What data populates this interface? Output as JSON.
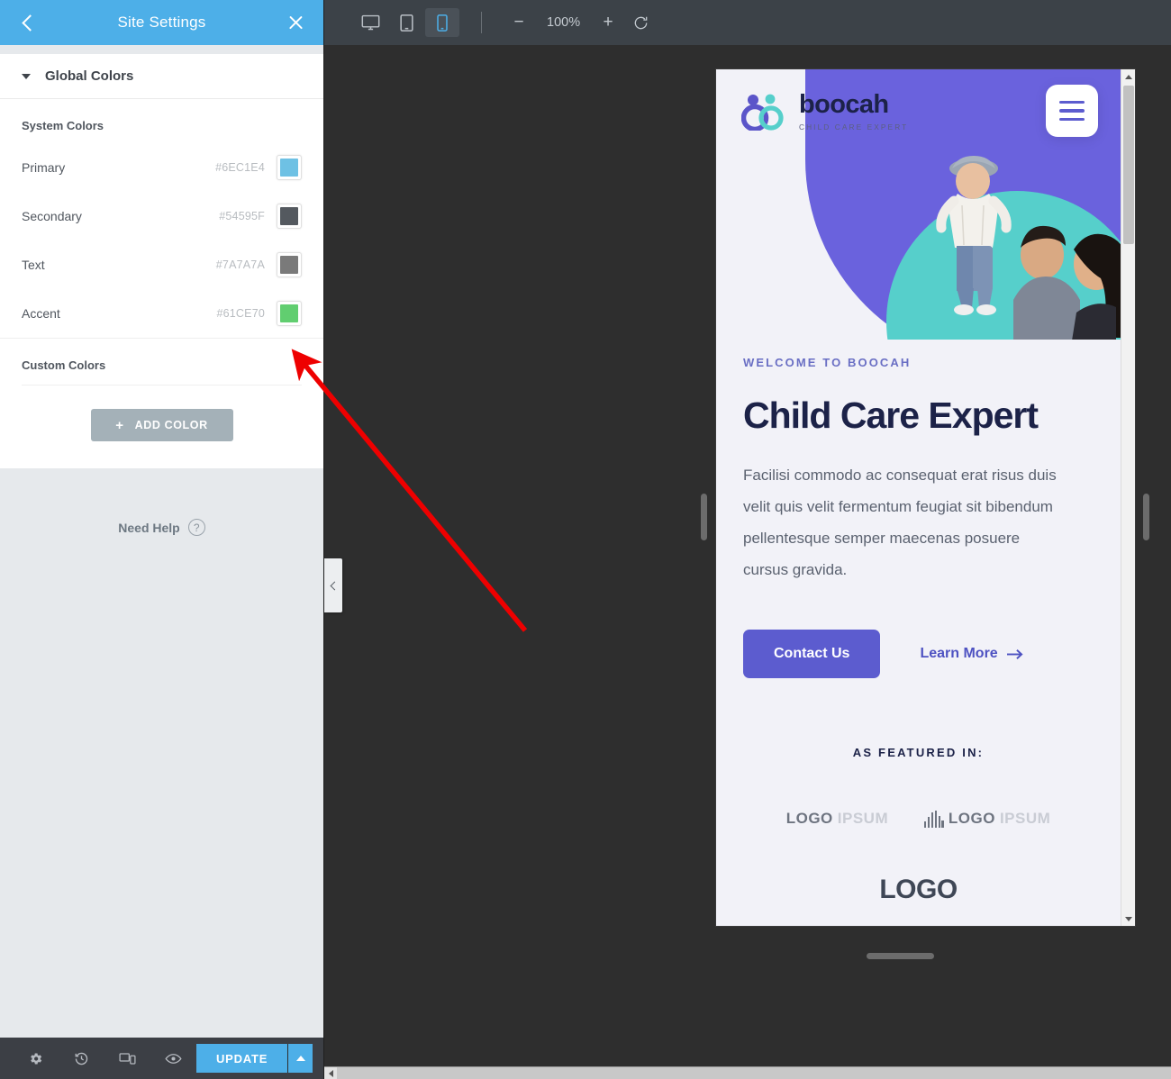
{
  "panel": {
    "header": {
      "title": "Site Settings",
      "back_icon": "chevron-left-icon",
      "close_icon": "close-icon"
    },
    "accordion": {
      "label": "Global Colors"
    },
    "system_colors": {
      "title": "System Colors",
      "rows": [
        {
          "name": "Primary",
          "hex": "#6EC1E4"
        },
        {
          "name": "Secondary",
          "hex": "#54595F"
        },
        {
          "name": "Text",
          "hex": "#7A7A7A"
        },
        {
          "name": "Accent",
          "hex": "#61CE70"
        }
      ]
    },
    "custom_colors": {
      "title": "Custom Colors",
      "add_button": "ADD COLOR",
      "add_icon": "plus-icon"
    },
    "need_help": {
      "label": "Need Help",
      "icon": "question-circle-icon"
    },
    "footer": {
      "icons": [
        "gear-icon",
        "history-icon",
        "responsive-mode-icon",
        "preview-icon"
      ],
      "update_label": "UPDATE",
      "caret_icon": "caret-up-icon"
    }
  },
  "toolbar": {
    "devices": [
      {
        "name": "desktop",
        "active": false
      },
      {
        "name": "tablet",
        "active": false
      },
      {
        "name": "mobile",
        "active": true
      }
    ],
    "zoom_out": "−",
    "zoom_value": "100%",
    "zoom_in": "+",
    "reset_icon": "reset-icon"
  },
  "preview": {
    "logo": {
      "name": "boocah",
      "tagline": "CHILD CARE EXPERT"
    },
    "menu_icon": "hamburger-menu-icon",
    "eyebrow": "WELCOME TO BOOCAH",
    "heading": "Child Care Expert",
    "paragraph": "Facilisi commodo ac consequat erat risus duis velit quis velit fermentum feugiat sit bibendum pellentesque semper maecenas posuere cursus gravida.",
    "primary_cta": "Contact Us",
    "secondary_cta": "Learn More",
    "secondary_cta_icon": "arrow-right-icon",
    "featured_label": "AS FEATURED IN:",
    "featured_logos": [
      {
        "bold": "LOGO",
        "light": "IPSUM"
      },
      {
        "bold": "LOGO",
        "light": "IPSUM"
      }
    ],
    "featured_logo_partial": "LOGO"
  },
  "colors": {
    "panel_header": "#4dafe8",
    "accent_purple": "#5c5ccf",
    "accent_teal": "#56cfcb",
    "heading_navy": "#1c2248",
    "annotation_arrow": "#ee0000"
  }
}
